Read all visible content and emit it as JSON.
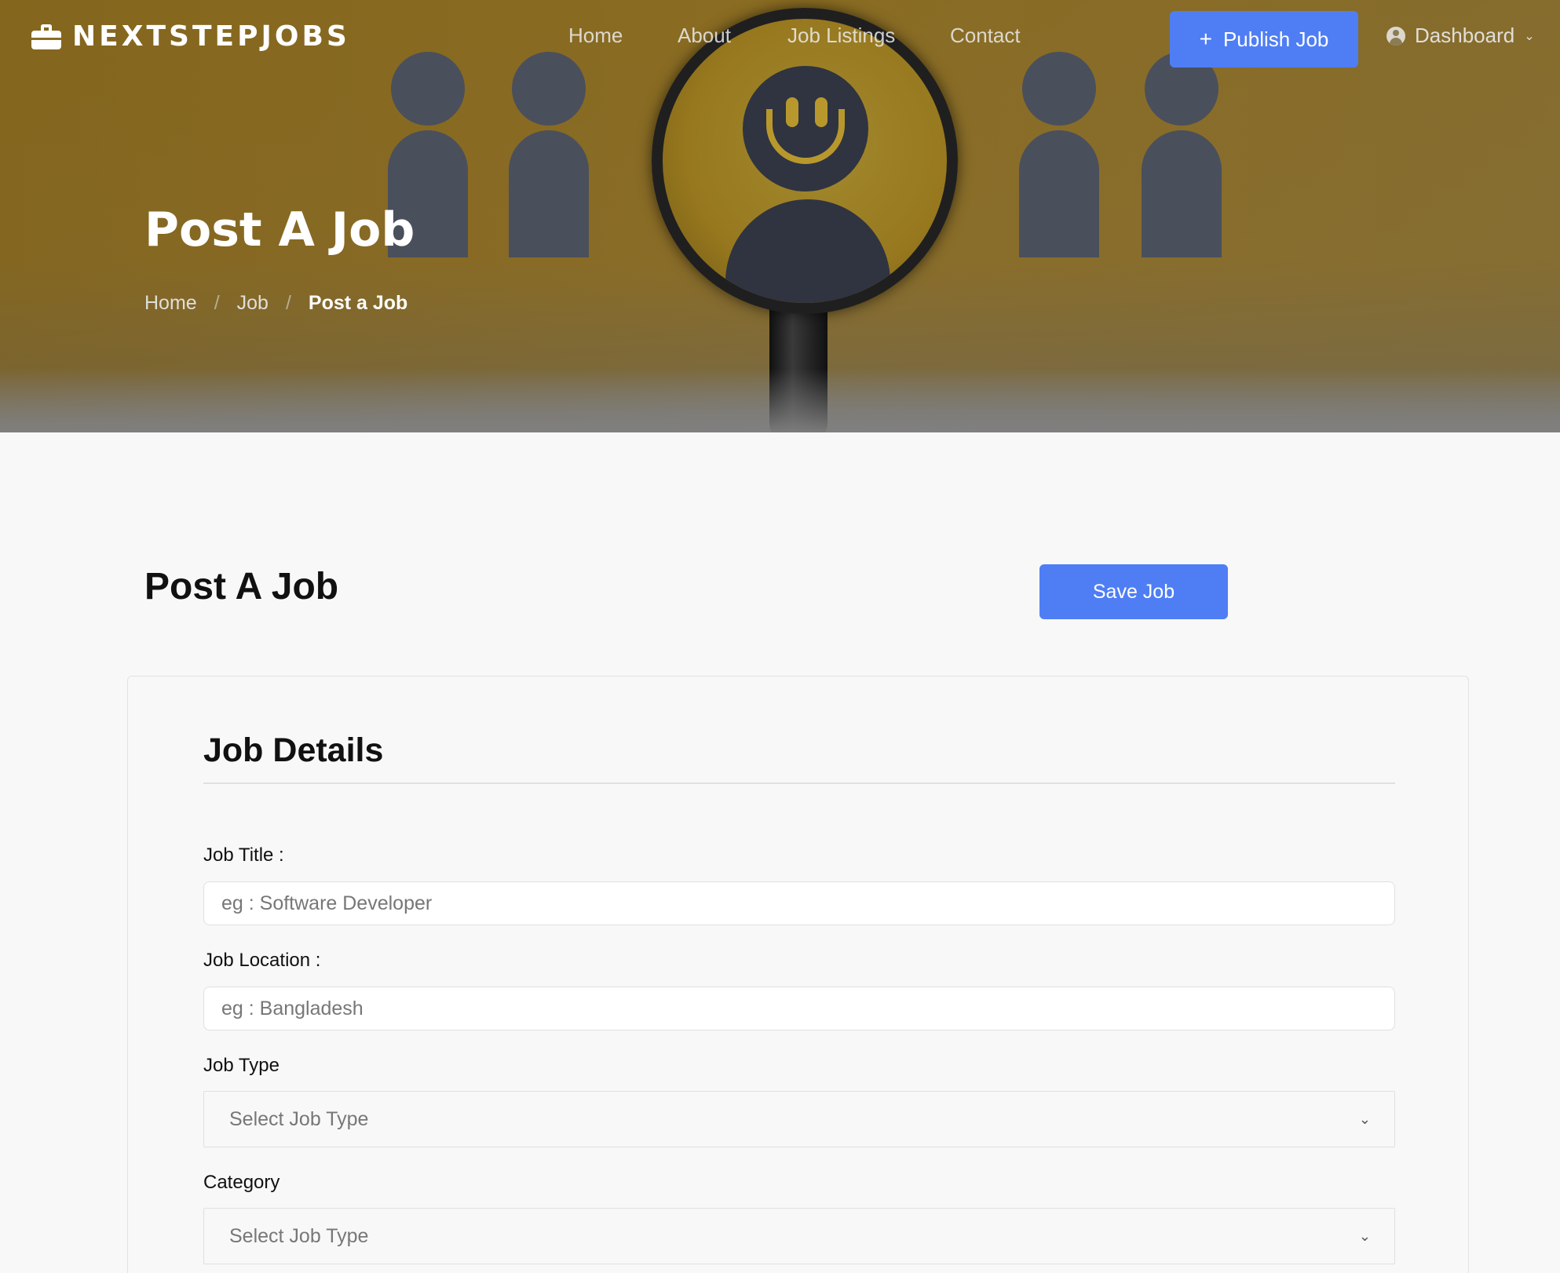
{
  "brand": {
    "name": "NEXTSTEPJOBS",
    "icon": "briefcase-icon"
  },
  "nav": {
    "items": [
      {
        "label": "Home"
      },
      {
        "label": "About"
      },
      {
        "label": "Job Listings"
      },
      {
        "label": "Contact"
      }
    ],
    "publish_button": {
      "icon": "plus-icon",
      "icon_glyph": "+",
      "label": "Publish Job"
    },
    "dashboard": {
      "icon": "user-circle-icon",
      "label": "Dashboard",
      "chevron": "⌄"
    }
  },
  "hero": {
    "title": "Post A Job",
    "breadcrumb": {
      "items": [
        "Home",
        "Job"
      ],
      "separator": "/",
      "current": "Post a Job"
    }
  },
  "main": {
    "heading": "Post A Job",
    "save_button": "Save Job"
  },
  "form": {
    "section_title": "Job Details",
    "job_title": {
      "label": "Job Title :",
      "placeholder": "eg : Software Developer",
      "value": ""
    },
    "job_location": {
      "label": "Job Location :",
      "placeholder": "eg : Bangladesh",
      "value": ""
    },
    "job_type": {
      "label": "Job Type",
      "selected": "Select Job Type",
      "chevron": "⌄"
    },
    "category": {
      "label": "Category",
      "selected": "Select Job Type",
      "chevron": "⌄"
    }
  },
  "colors": {
    "accent": "#4f7ef4",
    "hero_gold": "#8a6c22",
    "figure_slate": "#4a4f5c"
  }
}
